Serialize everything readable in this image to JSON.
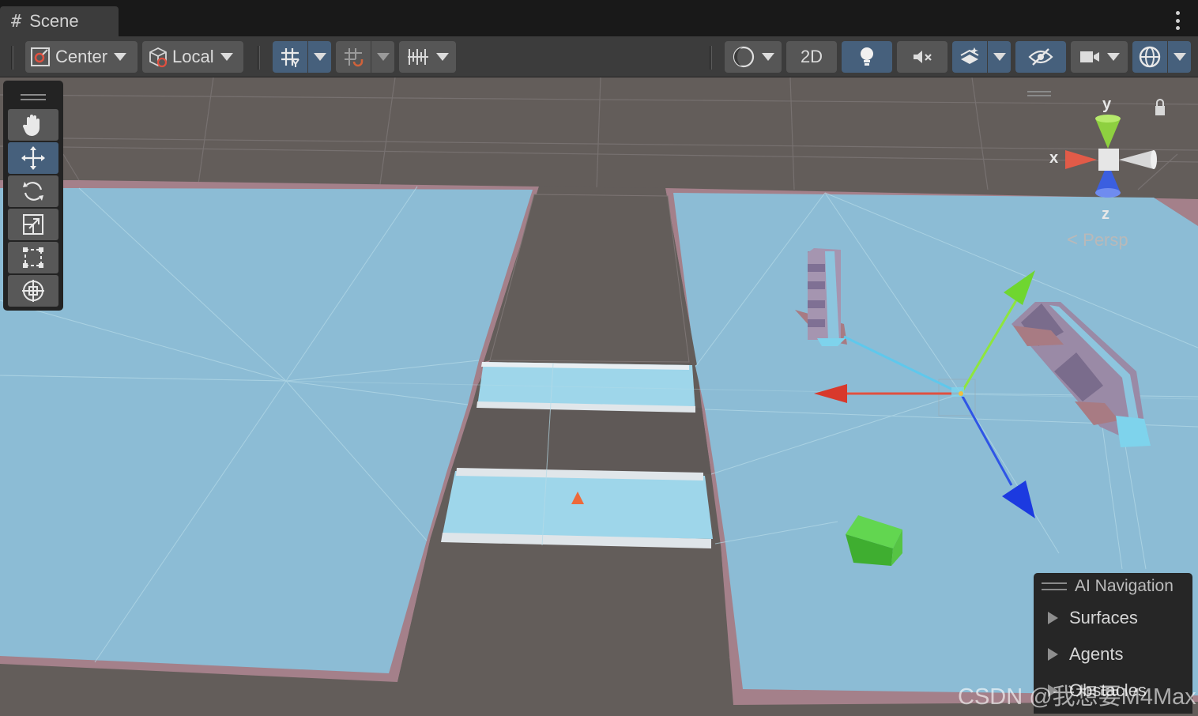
{
  "tab": {
    "label": "Scene",
    "icon": "hash-icon"
  },
  "toolbar": {
    "pivot_label": "Center",
    "space_label": "Local",
    "mode_2d_label": "2D"
  },
  "tools": [
    "hand-tool",
    "move-tool",
    "rotate-tool",
    "scale-tool",
    "rect-tool",
    "transform-tool"
  ],
  "active_tool": "move-tool",
  "gizmo": {
    "x": "x",
    "y": "y",
    "z": "z",
    "projection": "Persp"
  },
  "ai_navigation": {
    "title": "AI Navigation",
    "items": [
      "Surfaces",
      "Agents",
      "Obstacles"
    ]
  },
  "watermark": "CSDN @我想要M4Max",
  "colors": {
    "navmesh": "#8cc0d8",
    "ground": "#635d5a",
    "border": "#a87b83",
    "x_axis": "#e0503f",
    "y_axis": "#8ee63e",
    "z_axis": "#2f55e6",
    "active_button": "#46607c"
  }
}
